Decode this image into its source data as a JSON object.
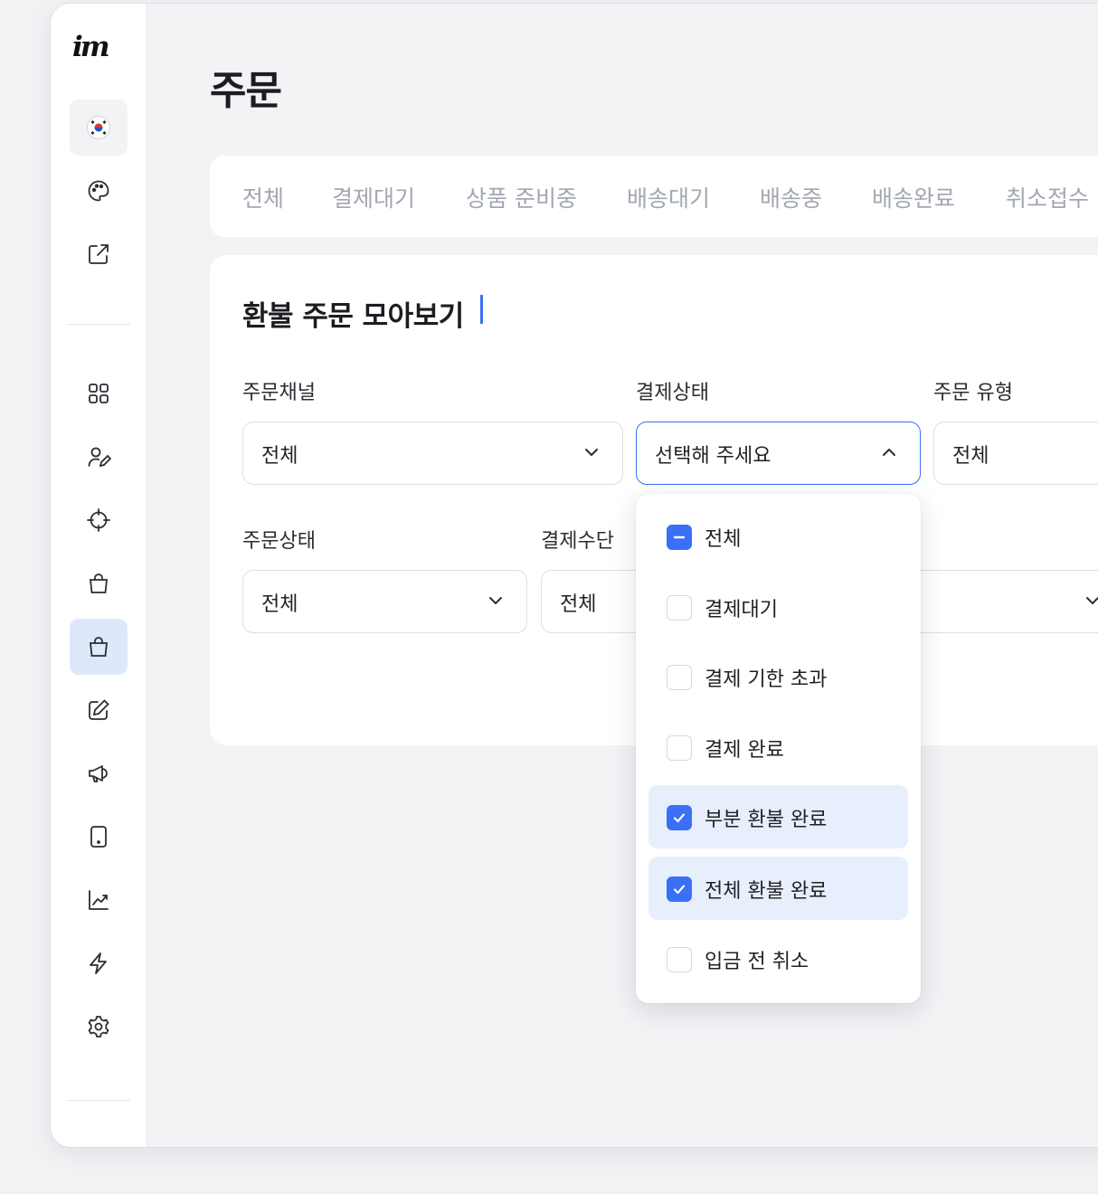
{
  "page": {
    "title": "주문"
  },
  "sidebar": {
    "logo": "im",
    "items": [
      {
        "name": "korea-flag-icon"
      },
      {
        "name": "palette-icon"
      },
      {
        "name": "external-link-icon"
      },
      {
        "name": "dashboard-grid-icon"
      },
      {
        "name": "user-edit-icon"
      },
      {
        "name": "crosshair-icon"
      },
      {
        "name": "shopping-bag-icon"
      },
      {
        "name": "orders-bag-icon",
        "active": true
      },
      {
        "name": "edit-icon"
      },
      {
        "name": "megaphone-icon"
      },
      {
        "name": "mobile-icon"
      },
      {
        "name": "analytics-icon"
      },
      {
        "name": "lightning-icon"
      },
      {
        "name": "settings-icon"
      }
    ]
  },
  "tabs": [
    "전체",
    "결제대기",
    "상품 준비중",
    "배송대기",
    "배송중",
    "배송완료",
    "취소접수"
  ],
  "filter": {
    "title": "환불 주문 모아보기",
    "order_channel": {
      "label": "주문채널",
      "value": "전체"
    },
    "payment_status": {
      "label": "결제상태",
      "placeholder": "선택해 주세요"
    },
    "order_type": {
      "label": "주문 유형",
      "value": "전체"
    },
    "order_status": {
      "label": "주문상태",
      "value": "전체"
    },
    "payment_method": {
      "label": "결제수단",
      "value": "전체"
    }
  },
  "dropdown": {
    "options": [
      {
        "label": "전체",
        "state": "indeterminate"
      },
      {
        "label": "결제대기",
        "state": "unchecked"
      },
      {
        "label": "결제 기한 초과",
        "state": "unchecked"
      },
      {
        "label": "결제 완료",
        "state": "unchecked"
      },
      {
        "label": "부분 환불 완료",
        "state": "checked"
      },
      {
        "label": "전체 환불 완료",
        "state": "checked"
      },
      {
        "label": "입금 전 취소",
        "state": "unchecked"
      }
    ]
  },
  "colors": {
    "accent": "#3a6ff7",
    "selected_bg": "#e7effc",
    "active_nav_bg": "#dde8fb"
  }
}
